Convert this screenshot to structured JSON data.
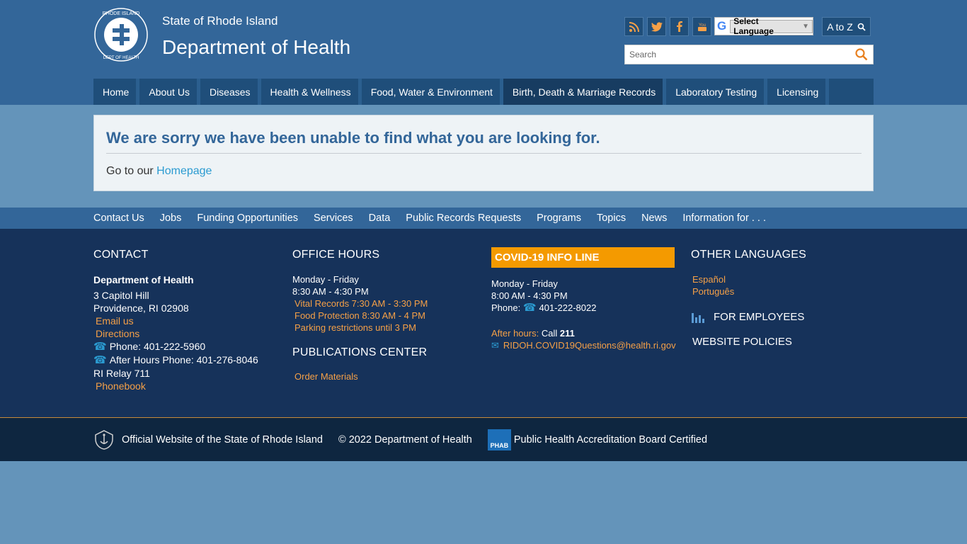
{
  "header": {
    "state_name": "State of Rhode Island",
    "dept_name": "Department of Health",
    "seal_text": "RHODE ISLAND DEPARTMENT OF HEALTH",
    "social": [
      "rss-icon",
      "twitter-icon",
      "facebook-icon",
      "youtube-icon"
    ],
    "language_label": "Select Language",
    "atoz_label": "A to Z",
    "search_placeholder": "Search"
  },
  "nav": {
    "items": [
      {
        "label": "Home"
      },
      {
        "label": "About Us"
      },
      {
        "label": "Diseases"
      },
      {
        "label": "Health & Wellness"
      },
      {
        "label": "Food, Water & Environment"
      },
      {
        "label": "Birth, Death & Marriage Records"
      },
      {
        "label": "Laboratory Testing"
      },
      {
        "label": "Licensing"
      }
    ]
  },
  "notfound": {
    "title": "We are sorry we have been unable to find what you are looking for.",
    "goto_prefix": "Go to our ",
    "homepage_link": "Homepage"
  },
  "footer_links": [
    "Contact Us",
    "Jobs",
    "Funding Opportunities",
    "Services",
    "Data",
    "Public Records Requests",
    "Programs",
    "Topics",
    "News",
    "Information for . . ."
  ],
  "contact": {
    "heading": "CONTACT",
    "org": "Department of Health",
    "address1": "3 Capitol Hill",
    "address2": "Providence, RI 02908",
    "email": "Email us",
    "directions": "Directions",
    "phone": "Phone: 401-222-5960",
    "after_hours": "After Hours Phone: 401-276-8046",
    "relay": "RI Relay 711",
    "phonebook": "Phonebook"
  },
  "office_hours": {
    "heading": "OFFICE HOURS",
    "days": "Monday - Friday",
    "hours": "8:30 AM - 4:30 PM",
    "vital": "Vital Records 7:30 AM - 3:30 PM",
    "food": "Food Protection 8:30 AM - 4 PM",
    "parking": "Parking restrictions until 3 PM",
    "pubs_heading": "PUBLICATIONS CENTER",
    "order": "Order Materials"
  },
  "covid": {
    "heading": "COVID-19 INFO LINE",
    "days": "Monday - Friday",
    "hours": "8:00 AM - 4:30 PM",
    "phone_label": "Phone:",
    "phone": "401-222-8022",
    "after_label": "After hours:",
    "after_call": "Call",
    "after_num": "211",
    "email": "RIDOH.COVID19Questions@health.ri.gov"
  },
  "other": {
    "heading": "OTHER LANGUAGES",
    "espanol": "Español",
    "portugues": "Português",
    "employees": "FOR EMPLOYEES",
    "policies": "WEBSITE POLICIES"
  },
  "bottom": {
    "official": "Official Website of the State of Rhode Island",
    "copyright": "© 2022 Department of Health",
    "phab_logo": "PHAB",
    "phab": "Public Health Accreditation Board Certified"
  },
  "colors": {
    "header_bg": "#336699",
    "footer_bg": "#16325a",
    "accent_orange": "#f5a047",
    "covid_orange": "#f49a00",
    "link_blue": "#2b9bd1"
  }
}
